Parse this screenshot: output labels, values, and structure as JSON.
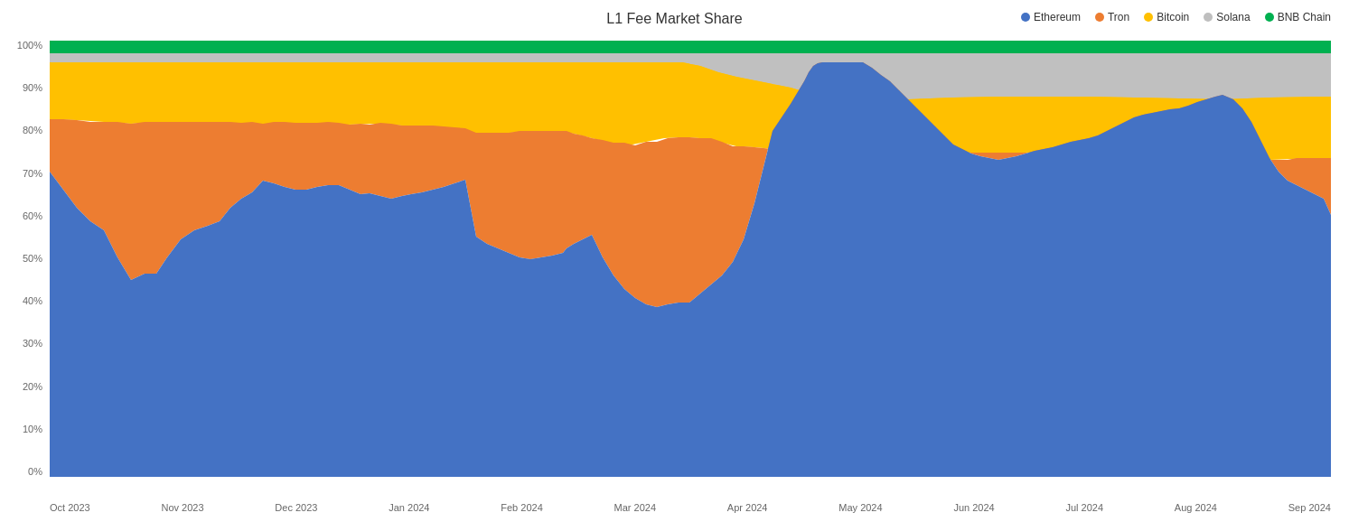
{
  "title": "L1 Fee Market Share",
  "legend": {
    "items": [
      {
        "name": "Ethereum",
        "color": "#4472C4"
      },
      {
        "name": "Tron",
        "color": "#ED7D31"
      },
      {
        "name": "Bitcoin",
        "color": "#FFC000"
      },
      {
        "name": "Solana",
        "color": "#BFBFBF"
      },
      {
        "name": "BNB Chain",
        "color": "#00B050"
      }
    ]
  },
  "yAxis": {
    "labels": [
      "100%",
      "90%",
      "80%",
      "70%",
      "60%",
      "50%",
      "40%",
      "30%",
      "20%",
      "10%",
      "0%"
    ]
  },
  "xAxis": {
    "labels": [
      "Oct 2023",
      "Nov 2023",
      "Dec 2023",
      "Jan 2024",
      "Feb 2024",
      "Mar 2024",
      "Apr 2024",
      "May 2024",
      "Jun 2024",
      "Jul 2024",
      "Aug 2024",
      "Sep 2024"
    ]
  },
  "colors": {
    "ethereum": "#4472C4",
    "tron": "#ED7D31",
    "bitcoin": "#FFC000",
    "solana": "#BFBFBF",
    "bnbchain": "#00B050"
  }
}
